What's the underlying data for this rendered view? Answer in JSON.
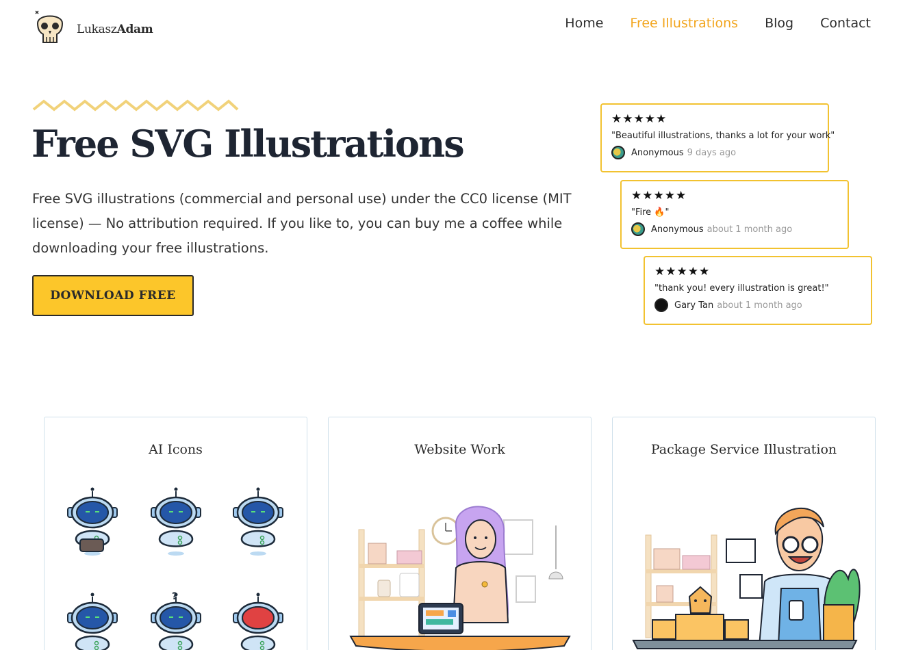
{
  "brand": {
    "name_light": "Lukasz",
    "name_bold": "Adam"
  },
  "nav": {
    "items": [
      {
        "label": "Home"
      },
      {
        "label": "Free Illustrations",
        "active": true
      },
      {
        "label": "Blog"
      },
      {
        "label": "Contact"
      }
    ]
  },
  "hero": {
    "title": "Free SVG Illustrations",
    "description": "Free SVG illustrations (commercial and personal use) under the CC0 license (MIT license) — No attribution required. If you like to, you can buy me a coffee while downloading your free illustrations.",
    "cta_label": "DOWNLOAD FREE"
  },
  "reviews": [
    {
      "stars": "★★★★★",
      "rating": 5,
      "quote": "\"Beautiful illustrations, thanks a lot for your work\"",
      "author": "Anonymous",
      "time": "9 days ago"
    },
    {
      "stars": "★★★★★",
      "rating": 5,
      "quote": "\"Fire 🔥\"",
      "author": "Anonymous",
      "time": "about 1 month ago"
    },
    {
      "stars": "★★★★★",
      "rating": 5,
      "quote": "\"thank you! every illustration is great!\"",
      "author": "Gary Tan",
      "time": "about 1 month ago"
    }
  ],
  "cards": [
    {
      "title": "AI Icons"
    },
    {
      "title": "Website Work"
    },
    {
      "title": "Package Service Illustration"
    }
  ],
  "colors": {
    "accent": "#f2a51d",
    "button": "#fcc62a",
    "review_border": "#f2c230",
    "card_border": "#cfe0ea",
    "title": "#1e2532"
  }
}
